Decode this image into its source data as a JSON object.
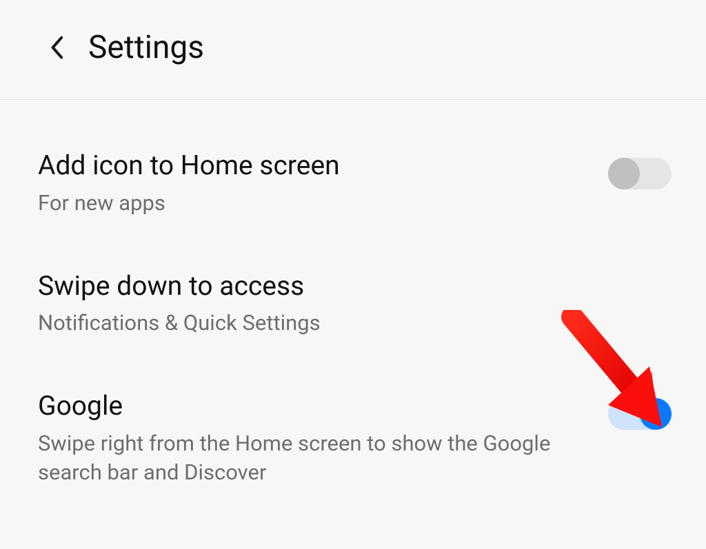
{
  "header": {
    "title": "Settings"
  },
  "settings": [
    {
      "title": "Add icon to Home screen",
      "subtitle": "For new apps",
      "toggle": "off"
    },
    {
      "title": "Swipe down to access",
      "subtitle": "Notifications & Quick Settings",
      "toggle": null
    },
    {
      "title": "Google",
      "subtitle": "Swipe right from the Home screen to show the Google search bar and Discover",
      "toggle": "on"
    }
  ],
  "annotation": {
    "arrow_target": "google-toggle",
    "arrow_color": "#fa0f0c"
  }
}
